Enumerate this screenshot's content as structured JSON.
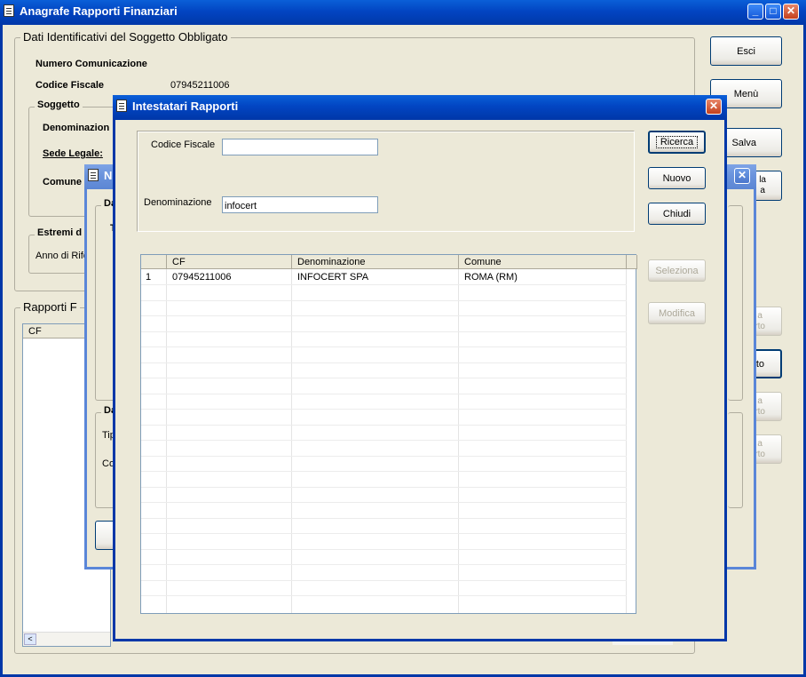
{
  "main_window": {
    "title": "Anagrafe Rapporti Finanziari",
    "caption_buttons": {
      "minimize": "_",
      "maximize": "□",
      "close": "✕"
    },
    "group_soggetto_obbligato": {
      "legend": "Dati Identificativi del Soggetto Obbligato",
      "numero_comunicazione_label": "Numero Comunicazione",
      "codice_fiscale_label": "Codice Fiscale",
      "codice_fiscale_value": "07945211006",
      "soggetto": {
        "legend": "Soggetto",
        "denominazione_label": "Denominazion",
        "sede_legale_label": "Sede Legale:",
        "comune_label": "Comune"
      },
      "estremi": {
        "legend": "Estremi d",
        "anno_label": "Anno di Rife"
      }
    },
    "rapporti": {
      "legend": "Rapporti F",
      "col_cf": "CF"
    },
    "buttons": {
      "esci": "Esci",
      "menu": "Menù",
      "salva": "Salva"
    },
    "partial_buttons": {
      "p1": "la\na",
      "p2": "a\nrto",
      "p3": "rto",
      "p4": "a\nrto",
      "p5": "a\nrto"
    }
  },
  "middle_window": {
    "title_partial": "N",
    "group1_legend": "Da",
    "group1_label": "T",
    "group2_legend": "Da",
    "tip_label": "Tip",
    "co_label": "Co"
  },
  "dialog": {
    "title": "Intestatari Rapporti",
    "codice_fiscale_label": "Codice Fiscale",
    "codice_fiscale_value": "",
    "denominazione_label": "Denominazione",
    "denominazione_value": "infocert",
    "buttons": {
      "ricerca": "Ricerca",
      "nuovo": "Nuovo",
      "chiudi": "Chiudi",
      "seleziona": "Seleziona",
      "modifica": "Modifica"
    },
    "table": {
      "headers": [
        "CF",
        "Denominazione",
        "Comune"
      ],
      "rows": [
        {
          "num": "1",
          "cf": "07945211006",
          "denominazione": "INFOCERT SPA",
          "comune": "ROMA (RM)"
        }
      ]
    }
  }
}
